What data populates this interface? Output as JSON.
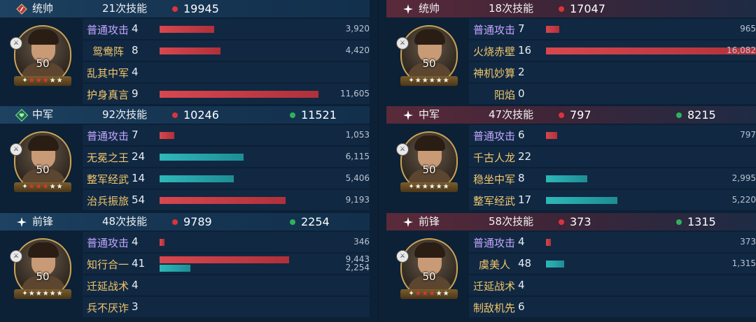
{
  "left": {
    "blocks": [
      {
        "role": "统帅",
        "skills": "21次技能",
        "damage": "19945",
        "heal": null,
        "level": "50",
        "stars_red": 3,
        "stars_total": 5,
        "rows": [
          {
            "name": "普通攻击",
            "count": "4",
            "name_style": "basic",
            "value": "3,920",
            "bar_red": 0.14,
            "bar_teal": 0
          },
          {
            "name": "鸳鸯阵",
            "count": "8",
            "name_style": "gold",
            "value": "4,420",
            "bar_red": 0.155,
            "bar_teal": 0
          },
          {
            "name": "乱其中军",
            "count": "4",
            "name_style": "gold",
            "value": "",
            "bar_red": 0,
            "bar_teal": 0
          },
          {
            "name": "护身真言",
            "count": "9",
            "name_style": "gold",
            "value": "11,605",
            "bar_red": 0.405,
            "bar_teal": 0
          }
        ]
      },
      {
        "role": "中军",
        "skills": "92次技能",
        "damage": "10246",
        "heal": "11521",
        "level": "50",
        "stars_red": 3,
        "stars_total": 5,
        "rows": [
          {
            "name": "普通攻击",
            "count": "7",
            "name_style": "basic",
            "value": "1,053",
            "bar_red": 0.037,
            "bar_teal": 0
          },
          {
            "name": "无冕之王",
            "count": "24",
            "name_style": "gold",
            "value": "6,115",
            "bar_red": 0,
            "bar_teal": 0.214
          },
          {
            "name": "整军经武",
            "count": "14",
            "name_style": "gold",
            "value": "5,406",
            "bar_red": 0,
            "bar_teal": 0.189
          },
          {
            "name": "治兵振旅",
            "count": "54",
            "name_style": "gold",
            "value": "9,193",
            "bar_red": 0.322,
            "bar_teal": 0
          }
        ]
      },
      {
        "role": "前锋",
        "skills": "48次技能",
        "damage": "9789",
        "heal": "2254",
        "level": "50",
        "stars_red": 0,
        "stars_total": 5,
        "rows": [
          {
            "name": "普通攻击",
            "count": "4",
            "name_style": "basic",
            "value": "346",
            "bar_red": 0.012,
            "bar_teal": 0
          },
          {
            "name": "知行合一",
            "count": "41",
            "name_style": "gold",
            "value": "9,443",
            "value2": "2,254",
            "bar_red": 0.33,
            "bar_teal": 0.079
          },
          {
            "name": "迁延战术",
            "count": "4",
            "name_style": "gold",
            "value": "",
            "bar_red": 0,
            "bar_teal": 0
          },
          {
            "name": "兵不厌诈",
            "count": "3",
            "name_style": "gold",
            "value": "",
            "bar_red": 0,
            "bar_teal": 0
          }
        ]
      }
    ]
  },
  "right": {
    "blocks": [
      {
        "role": "统帅",
        "skills": "18次技能",
        "damage": "17047",
        "heal": null,
        "level": "50",
        "stars_red": 0,
        "stars_total": 5,
        "rows": [
          {
            "name": "普通攻击",
            "count": "7",
            "name_style": "basic",
            "value": "965",
            "bar_red": 0.034,
            "bar_teal": 0
          },
          {
            "name": "火烧赤壁",
            "count": "16",
            "name_style": "gold",
            "value": "16,082",
            "bar_red": 0.562,
            "bar_teal": 0
          },
          {
            "name": "神机妙算",
            "count": "2",
            "name_style": "gold",
            "value": "",
            "bar_red": 0,
            "bar_teal": 0
          },
          {
            "name": "阳焰",
            "count": "0",
            "name_style": "gold",
            "value": "",
            "bar_red": 0,
            "bar_teal": 0
          }
        ]
      },
      {
        "role": "中军",
        "skills": "47次技能",
        "damage": "797",
        "heal": "8215",
        "level": "50",
        "stars_red": 0,
        "stars_total": 5,
        "rows": [
          {
            "name": "普通攻击",
            "count": "6",
            "name_style": "basic",
            "value": "797",
            "bar_red": 0.028,
            "bar_teal": 0
          },
          {
            "name": "千古人龙",
            "count": "22",
            "name_style": "gold",
            "value": "",
            "bar_red": 0,
            "bar_teal": 0
          },
          {
            "name": "稳坐中军",
            "count": "8",
            "name_style": "gold",
            "value": "2,995",
            "bar_red": 0,
            "bar_teal": 0.105
          },
          {
            "name": "整军经武",
            "count": "17",
            "name_style": "gold",
            "value": "5,220",
            "bar_red": 0,
            "bar_teal": 0.182
          }
        ]
      },
      {
        "role": "前锋",
        "skills": "58次技能",
        "damage": "373",
        "heal": "1315",
        "level": "50",
        "stars_red": 3,
        "stars_total": 5,
        "rows": [
          {
            "name": "普通攻击",
            "count": "4",
            "name_style": "basic",
            "value": "373",
            "bar_red": 0.013,
            "bar_teal": 0
          },
          {
            "name": "虞美人",
            "count": "48",
            "name_style": "gold",
            "value": "1,315",
            "bar_red": 0,
            "bar_teal": 0.046
          },
          {
            "name": "迁延战术",
            "count": "4",
            "name_style": "gold",
            "value": "",
            "bar_red": 0,
            "bar_teal": 0
          },
          {
            "name": "制敌机先",
            "count": "6",
            "name_style": "gold",
            "value": "",
            "bar_red": 0,
            "bar_teal": 0
          }
        ]
      }
    ]
  },
  "colors": {
    "damage_bar": "#d8474e",
    "heal_bar": "#2fb8b8",
    "basic_attack": "#c4a6ff",
    "skill_name": "#f0c66a"
  },
  "icons": {
    "commander": "diamond-flag-icon",
    "center": "heart-shield-icon",
    "vanguard": "sparkle-icon"
  }
}
